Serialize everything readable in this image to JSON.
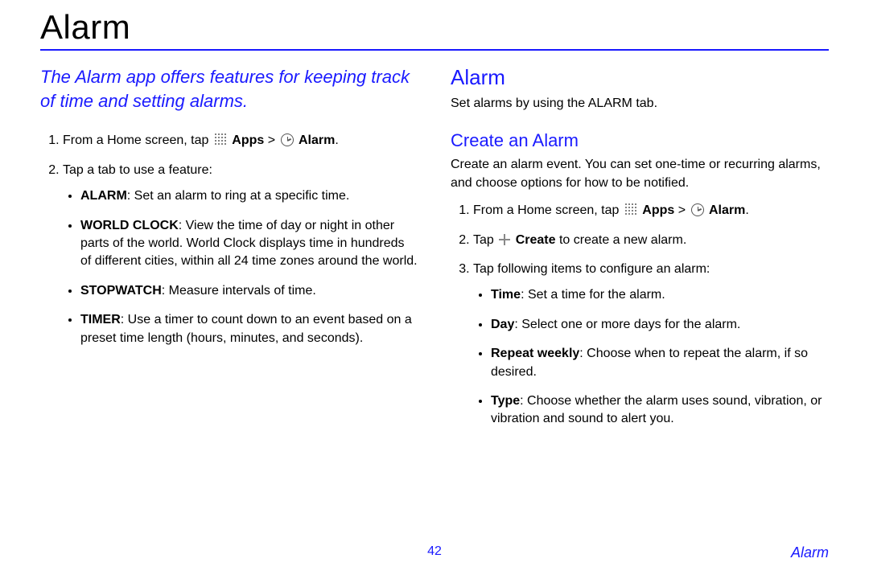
{
  "page_title": "Alarm",
  "intro": "The Alarm app offers features for keeping track of time and setting alarms.",
  "left": {
    "step1_prefix": "From a Home screen, tap ",
    "step1_apps": "Apps",
    "step1_gt": " > ",
    "step1_alarm": "Alarm",
    "step1_suffix": ".",
    "step2": "Tap a tab to use a feature:",
    "bullets": {
      "alarm_label": "ALARM",
      "alarm_text": ": Set an alarm to ring at a specific time.",
      "world_label": "WORLD CLOCK",
      "world_text": ": View the time of day or night in other parts of the world. World Clock displays time in hundreds of different cities, within all 24 time zones around the world.",
      "stop_label": "STOPWATCH",
      "stop_text": ": Measure intervals of time.",
      "timer_label": "TIMER",
      "timer_text": ": Use a timer to count down to an event based on a preset time length (hours, minutes, and seconds)."
    }
  },
  "right": {
    "h2": "Alarm",
    "p1": "Set alarms by using the ALARM tab.",
    "h3": "Create an Alarm",
    "p2": "Create an alarm event. You can set one-time or recurring alarms, and choose options for how to be notified.",
    "step1_prefix": "From a Home screen, tap ",
    "step1_apps": "Apps",
    "step1_gt": " > ",
    "step1_alarm": "Alarm",
    "step1_suffix": ".",
    "step2_prefix": "Tap ",
    "step2_create": "Create",
    "step2_suffix": " to create a new alarm.",
    "step3": "Tap following items to configure an alarm:",
    "bullets": {
      "time_label": "Time",
      "time_text": ": Set a time for the alarm.",
      "day_label": "Day",
      "day_text": ": Select one or more days for the alarm.",
      "repeat_label": "Repeat weekly",
      "repeat_text": ": Choose when to repeat the alarm, if so desired.",
      "type_label": "Type",
      "type_text": ": Choose whether the alarm uses sound, vibration, or vibration and sound to alert you."
    }
  },
  "footer": {
    "page_number": "42",
    "section": "Alarm"
  }
}
